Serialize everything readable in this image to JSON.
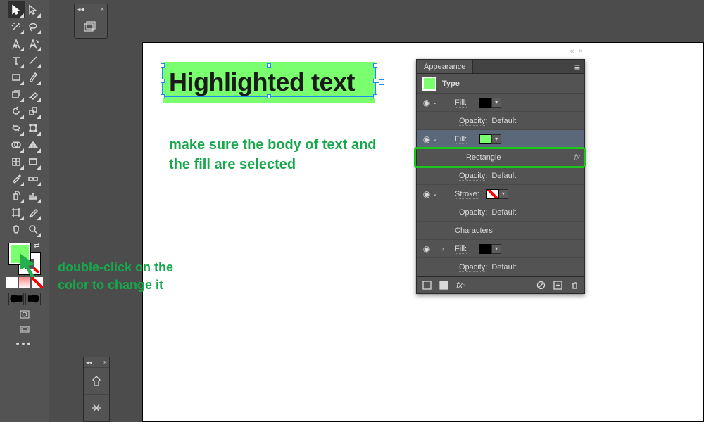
{
  "toolbar": {
    "fill_color": "#7aff6e",
    "stroke": "none"
  },
  "canvas": {
    "highlight_text": "Highlighted text",
    "highlight_color": "#7aff6e"
  },
  "notes": {
    "body_select": "make sure the body of text and the fill are selected",
    "dblclick": "double-click on the color to change it"
  },
  "appearance": {
    "title": "Appearance",
    "object_type": "Type",
    "rows": {
      "fill1_label": "Fill:",
      "opacity_label": "Opacity:",
      "opacity_value": "Default",
      "fill2_label": "Fill:",
      "rectangle": "Rectangle",
      "stroke_label": "Stroke:",
      "characters": "Characters",
      "fill3_label": "Fill:"
    }
  }
}
